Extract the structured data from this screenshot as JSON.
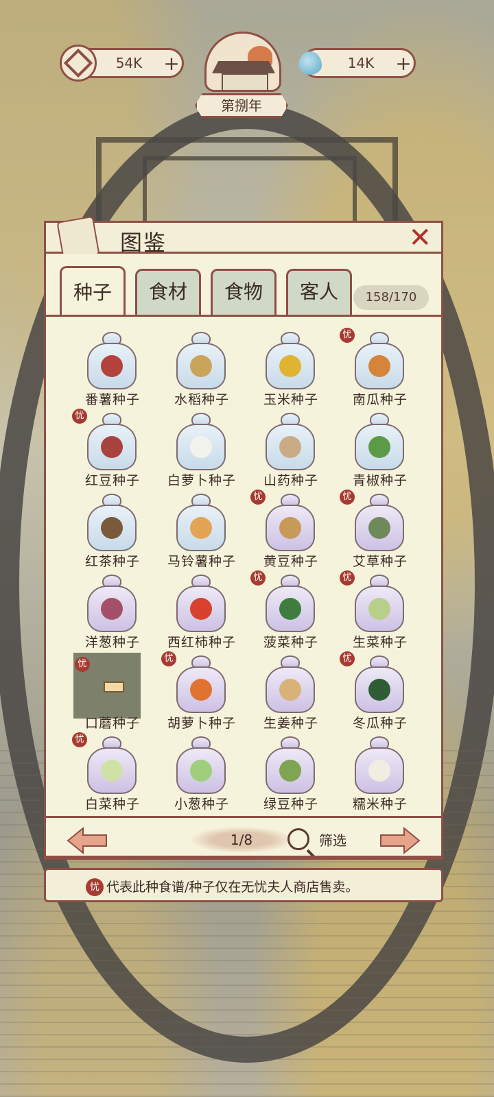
{
  "top_bar": {
    "coins": "54K",
    "water": "14K",
    "plus": "+",
    "year": "第捌年"
  },
  "panel": {
    "title": "图鉴",
    "close": "✕",
    "tabs": [
      {
        "label": "种子",
        "active": true
      },
      {
        "label": "食材",
        "active": false
      },
      {
        "label": "食物",
        "active": false
      },
      {
        "label": "客人",
        "active": false
      }
    ],
    "count": "158/170",
    "page": "1/8",
    "filter": "筛选"
  },
  "seeds": [
    {
      "name": "番薯种子",
      "bag": "blue",
      "exclusive": false,
      "color": "#b2423b"
    },
    {
      "name": "水稻种子",
      "bag": "blue",
      "exclusive": false,
      "color": "#c9a45b"
    },
    {
      "name": "玉米种子",
      "bag": "blue",
      "exclusive": false,
      "color": "#e0b431"
    },
    {
      "name": "南瓜种子",
      "bag": "blue",
      "exclusive": true,
      "color": "#d6843a"
    },
    {
      "name": "红豆种子",
      "bag": "blue",
      "exclusive": true,
      "color": "#a9433d"
    },
    {
      "name": "白萝卜种子",
      "bag": "blue",
      "exclusive": false,
      "color": "#f3f3ee"
    },
    {
      "name": "山药种子",
      "bag": "blue",
      "exclusive": false,
      "color": "#c9ab85"
    },
    {
      "name": "青椒种子",
      "bag": "blue",
      "exclusive": false,
      "color": "#5d9a47"
    },
    {
      "name": "红茶种子",
      "bag": "blue",
      "exclusive": false,
      "color": "#7a5a3a"
    },
    {
      "name": "马铃薯种子",
      "bag": "blue",
      "exclusive": false,
      "color": "#e3a455"
    },
    {
      "name": "黄豆种子",
      "bag": "purple",
      "exclusive": true,
      "color": "#c79a5a"
    },
    {
      "name": "艾草种子",
      "bag": "purple",
      "exclusive": true,
      "color": "#6f8a5a"
    },
    {
      "name": "洋葱种子",
      "bag": "purple",
      "exclusive": false,
      "color": "#a4506a"
    },
    {
      "name": "西红柿种子",
      "bag": "purple",
      "exclusive": false,
      "color": "#d8412f"
    },
    {
      "name": "菠菜种子",
      "bag": "purple",
      "exclusive": true,
      "color": "#3f7d3f"
    },
    {
      "name": "生菜种子",
      "bag": "purple",
      "exclusive": true,
      "color": "#b7cf88"
    },
    {
      "name": "口蘑种子",
      "bag": "dim",
      "exclusive": true,
      "color": "#f2d9a5"
    },
    {
      "name": "胡萝卜种子",
      "bag": "purple",
      "exclusive": true,
      "color": "#e0732f"
    },
    {
      "name": "生姜种子",
      "bag": "purple",
      "exclusive": false,
      "color": "#d9b277"
    },
    {
      "name": "冬瓜种子",
      "bag": "purple",
      "exclusive": true,
      "color": "#2f5d35"
    },
    {
      "name": "白菜种子",
      "bag": "purple",
      "exclusive": true,
      "color": "#cfe1a6"
    },
    {
      "name": "小葱种子",
      "bag": "purple",
      "exclusive": false,
      "color": "#9fcf7c"
    },
    {
      "name": "绿豆种子",
      "bag": "purple",
      "exclusive": false,
      "color": "#7fa453"
    },
    {
      "name": "糯米种子",
      "bag": "purple",
      "exclusive": false,
      "color": "#f1ede0"
    }
  ],
  "exclusive_badge": "忧",
  "notice": "代表此种食谱/种子仅在无忧夫人商店售卖。",
  "colors": {
    "accent": "#8f4f45",
    "badge": "#a63b32",
    "parchment": "#f6f3dc"
  }
}
